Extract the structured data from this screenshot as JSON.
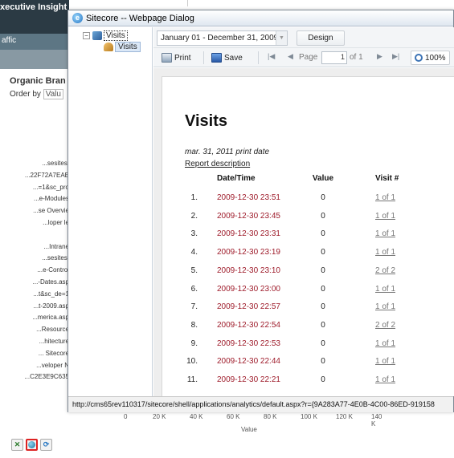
{
  "background": {
    "title": "xecutive Insight",
    "traffic_label": "affic",
    "heading": "Organic Bran",
    "order_by_label": "Order by",
    "order_by_value": "Valu",
    "list_items": [
      "...sesitest",
      "...22F72A7EAE",
      "...=1&sc_pro",
      "...e-Modules",
      "...se Overvie",
      "...loper le",
      "",
      "...Intrane",
      "...sesitest",
      "...e-Control",
      "...-Dates.asp",
      "...t&sc_de=1",
      "...t-2009.asp",
      "...merica.asp",
      "...Resource",
      "...hitecture",
      "... Sitecore",
      "...veloper N",
      "...C2E3E9C635"
    ],
    "axis_ticks": [
      "0",
      "20 K",
      "40 K",
      "60 K",
      "80 K",
      "100 K",
      "120 K",
      "140 K"
    ],
    "axis_title": "Value",
    "icons": [
      "excel-icon",
      "globe-icon",
      "refresh-icon"
    ]
  },
  "dialog": {
    "title": "Sitecore -- Webpage Dialog",
    "tree": {
      "root": "Visits",
      "child": "Visits"
    },
    "toolbar": {
      "date_range": "January 01 - December 31, 2009",
      "design_label": "Design",
      "print_label": "Print",
      "save_label": "Save",
      "page_label": "Page",
      "page_value": "1",
      "page_of": "of 1",
      "zoom": "100%"
    },
    "report": {
      "title": "Visits",
      "print_date": "mar. 31, 2011 print date",
      "description_link": "Report description",
      "columns": [
        "Date/Time",
        "Value",
        "Visit #"
      ],
      "rows": [
        {
          "n": "1.",
          "dt": "2009-12-30 23:51",
          "value": "0",
          "visit": "1 of 1"
        },
        {
          "n": "2.",
          "dt": "2009-12-30 23:45",
          "value": "0",
          "visit": "1 of 1"
        },
        {
          "n": "3.",
          "dt": "2009-12-30 23:31",
          "value": "0",
          "visit": "1 of 1"
        },
        {
          "n": "4.",
          "dt": "2009-12-30 23:19",
          "value": "0",
          "visit": "1 of 1"
        },
        {
          "n": "5.",
          "dt": "2009-12-30 23:10",
          "value": "0",
          "visit": "2 of 2"
        },
        {
          "n": "6.",
          "dt": "2009-12-30 23:00",
          "value": "0",
          "visit": "1 of 1"
        },
        {
          "n": "7.",
          "dt": "2009-12-30 22:57",
          "value": "0",
          "visit": "1 of 1"
        },
        {
          "n": "8.",
          "dt": "2009-12-30 22:54",
          "value": "0",
          "visit": "2 of 2"
        },
        {
          "n": "9.",
          "dt": "2009-12-30 22:53",
          "value": "0",
          "visit": "1 of 1"
        },
        {
          "n": "10.",
          "dt": "2009-12-30 22:44",
          "value": "0",
          "visit": "1 of 1"
        },
        {
          "n": "11.",
          "dt": "2009-12-30 22:21",
          "value": "0",
          "visit": "1 of 1"
        }
      ]
    },
    "status_url": "http://cms65rev110317/sitecore/shell/applications/analytics/default.aspx?r={9A283A77-4E0B-4C00-86ED-919158"
  }
}
